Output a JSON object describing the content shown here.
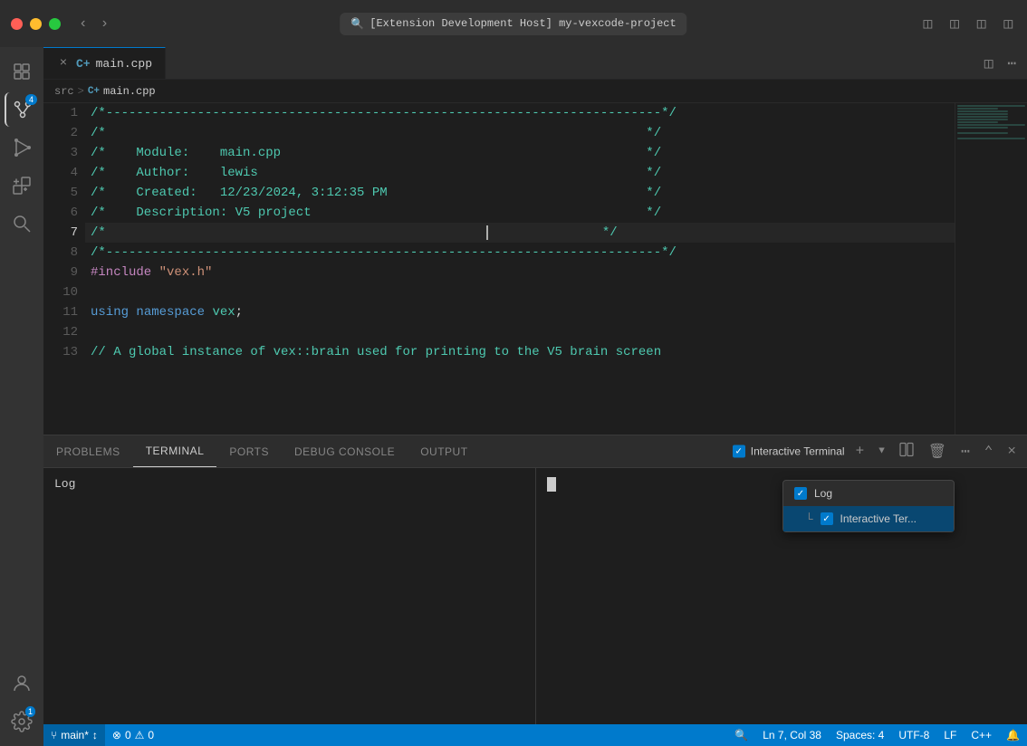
{
  "titlebar": {
    "title": "[Extension Development Host] my-vexcode-project",
    "nav_back": "‹",
    "nav_forward": "›"
  },
  "tab": {
    "name": "main.cpp",
    "icon": "C+",
    "modified": true
  },
  "breadcrumb": {
    "src": "src",
    "separator": ">",
    "file": "main.cpp"
  },
  "code_lines": [
    {
      "num": "1",
      "content": "/*-------------------------------------------------------------------------*/",
      "type": "dashed"
    },
    {
      "num": "2",
      "content": "/*                                                                       */",
      "type": "comment"
    },
    {
      "num": "3",
      "content": "/*    Module:    main.cpp                                                */",
      "type": "comment"
    },
    {
      "num": "4",
      "content": "/*    Author:    lewis                                                   */",
      "type": "comment"
    },
    {
      "num": "5",
      "content": "/*    Created:   12/23/2024, 3:12:35 PM                                  */",
      "type": "comment"
    },
    {
      "num": "6",
      "content": "/*    Description: V5 project                                            */",
      "type": "comment"
    },
    {
      "num": "7",
      "content": "/*                                                                       */",
      "type": "comment_cursor"
    },
    {
      "num": "8",
      "content": "/*-------------------------------------------------------------------------*/",
      "type": "dashed"
    },
    {
      "num": "9",
      "content": "#include \"vex.h\"",
      "type": "include"
    },
    {
      "num": "10",
      "content": "",
      "type": "empty"
    },
    {
      "num": "11",
      "content": "using namespace vex;",
      "type": "using"
    },
    {
      "num": "12",
      "content": "",
      "type": "empty"
    },
    {
      "num": "13",
      "content": "// A global instance of vex::brain used for printing to the V5 brain screen",
      "type": "comment2"
    }
  ],
  "panel": {
    "tabs": [
      "PROBLEMS",
      "TERMINAL",
      "PORTS",
      "DEBUG CONSOLE",
      "OUTPUT"
    ],
    "active_tab": "TERMINAL",
    "terminal_label": "Interactive Terminal",
    "log_text": "Log"
  },
  "dropdown": {
    "items": [
      {
        "label": "Log",
        "indent": false
      },
      {
        "label": "Interactive Ter...",
        "indent": true,
        "selected": true
      }
    ]
  },
  "status_bar": {
    "branch": "main*",
    "sync_icon": "↕",
    "errors": "0",
    "warnings": "0",
    "position": "Ln 7, Col 38",
    "spaces": "Spaces: 4",
    "encoding": "UTF-8",
    "line_ending": "LF",
    "language": "C++",
    "bell": "🔔"
  }
}
